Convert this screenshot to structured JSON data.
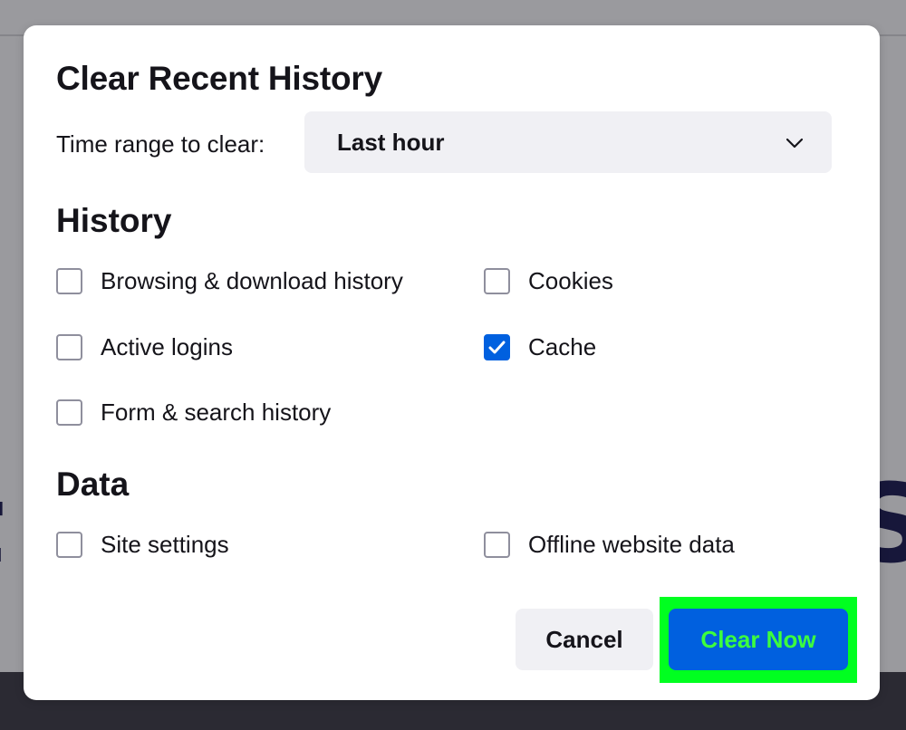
{
  "dialog": {
    "title": "Clear Recent History",
    "time_range": {
      "label": "Time range to clear:",
      "selected": "Last hour"
    },
    "sections": {
      "history": {
        "heading": "History",
        "items": [
          {
            "label": "Browsing & download history",
            "checked": false
          },
          {
            "label": "Cookies",
            "checked": false
          },
          {
            "label": "Active logins",
            "checked": false
          },
          {
            "label": "Cache",
            "checked": true
          },
          {
            "label": "Form & search history",
            "checked": false
          }
        ]
      },
      "data": {
        "heading": "Data",
        "items": [
          {
            "label": "Site settings",
            "checked": false
          },
          {
            "label": "Offline website data",
            "checked": false
          }
        ]
      }
    },
    "buttons": {
      "cancel": "Cancel",
      "clear_now": "Clear Now"
    }
  },
  "colors": {
    "accent": "#0060df",
    "highlight": "#00ff20",
    "backdrop": "#9a9a9e",
    "bottom_bar": "#2b2a33"
  },
  "icons": {
    "dropdown": "chevron-down-icon",
    "checkmark": "checkmark-icon"
  }
}
